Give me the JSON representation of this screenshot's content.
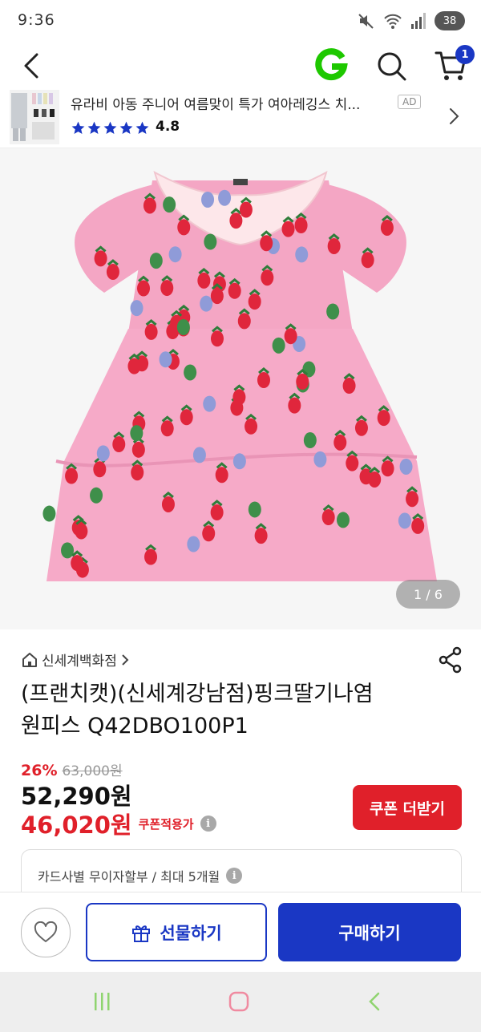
{
  "status_bar": {
    "time": "9:36",
    "battery": "38"
  },
  "header": {
    "back_icon": "chevron-left-icon",
    "logo_icon": "g-logo-icon",
    "search_icon": "search-icon",
    "cart_icon": "cart-icon",
    "cart_count": "1",
    "brand_color": "#1a37c4",
    "logo_color": "#1ec800"
  },
  "ad_banner": {
    "title": "유라비 아동 주니어 여름맞이 특가 여아레깅스 치...",
    "badge": "AD",
    "rating": "4.8",
    "stars": 5,
    "star_color": "#1a37c4"
  },
  "product": {
    "image_counter": "1 / 6",
    "store_name": "신세계백화점",
    "title_line1": "(프랜치캣)(신세계강남점)핑크딸기나염",
    "title_line2": "원피스 Q42DBO100P1",
    "discount_rate": "26%",
    "original_price": "63,000원",
    "sale_price": "52,290원",
    "coupon_price": "46,020원",
    "coupon_label": "쿠폰적용가",
    "coupon_button": "쿠폰 더받기",
    "installment": "카드사별 무이자할부 / 최대 5개월",
    "accent_color": "#e0202a"
  },
  "bottom_bar": {
    "wish_icon": "heart-icon",
    "gift_icon": "gift-icon",
    "gift_label": "선물하기",
    "buy_label": "구매하기"
  },
  "nav_bar": {
    "recent_icon": "recent-apps-icon",
    "home_icon": "home-icon",
    "back_icon": "back-icon"
  }
}
